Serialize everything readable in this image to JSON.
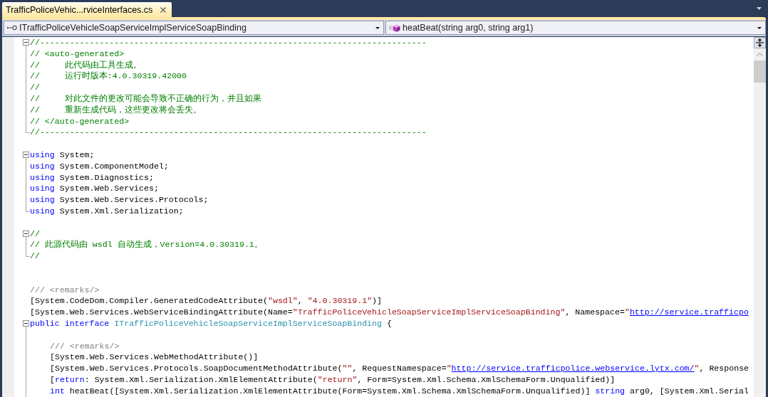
{
  "document_tabs": [
    {
      "label": "TrafficPoliceVehic...rviceInterfaces.cs",
      "selected": true
    }
  ],
  "navigation_bar": {
    "type_selector": {
      "value": "ITrafficPoliceVehicleSoapServiceImplServiceSoapBinding"
    },
    "member_selector": {
      "value": "heatBeat(string arg0, string arg1)"
    }
  },
  "editor": {
    "lines": [
      {
        "kind": "code",
        "outline": {
          "kind": "toggle",
          "expanded": true
        },
        "segments": [
          {
            "kind": "comment",
            "text": "//------------------------------------------------------------------------------"
          }
        ]
      },
      {
        "kind": "code",
        "outline": {
          "kind": "guide"
        },
        "segments": [
          {
            "kind": "comment",
            "text": "// <auto-generated>"
          }
        ]
      },
      {
        "kind": "code",
        "outline": {
          "kind": "guide"
        },
        "segments": [
          {
            "kind": "comment",
            "text": "//     此代码由工具生成。"
          }
        ]
      },
      {
        "kind": "code",
        "outline": {
          "kind": "guide"
        },
        "segments": [
          {
            "kind": "comment",
            "text": "//     运行时版本:4.0.30319.42000"
          }
        ]
      },
      {
        "kind": "code",
        "outline": {
          "kind": "guide"
        },
        "segments": [
          {
            "kind": "comment",
            "text": "//"
          }
        ]
      },
      {
        "kind": "code",
        "outline": {
          "kind": "guide"
        },
        "segments": [
          {
            "kind": "comment",
            "text": "//     对此文件的更改可能会导致不正确的行为，并且如果"
          }
        ]
      },
      {
        "kind": "code",
        "outline": {
          "kind": "guide"
        },
        "segments": [
          {
            "kind": "comment",
            "text": "//     重新生成代码，这些更改将会丢失。"
          }
        ]
      },
      {
        "kind": "code",
        "outline": {
          "kind": "guide"
        },
        "segments": [
          {
            "kind": "comment",
            "text": "// </auto-generated>"
          }
        ]
      },
      {
        "kind": "code",
        "outline": {
          "kind": "end"
        },
        "segments": [
          {
            "kind": "comment",
            "text": "//------------------------------------------------------------------------------"
          }
        ]
      },
      {
        "kind": "blank"
      },
      {
        "kind": "code",
        "outline": {
          "kind": "toggle",
          "expanded": true
        },
        "segments": [
          {
            "kind": "keyword",
            "text": "using"
          },
          {
            "kind": "plain",
            "text": " System;"
          }
        ]
      },
      {
        "kind": "code",
        "outline": {
          "kind": "guide"
        },
        "segments": [
          {
            "kind": "keyword",
            "text": "using"
          },
          {
            "kind": "plain",
            "text": " System.ComponentModel;"
          }
        ]
      },
      {
        "kind": "code",
        "outline": {
          "kind": "guide"
        },
        "segments": [
          {
            "kind": "keyword",
            "text": "using"
          },
          {
            "kind": "plain",
            "text": " System.Diagnostics;"
          }
        ]
      },
      {
        "kind": "code",
        "outline": {
          "kind": "guide"
        },
        "segments": [
          {
            "kind": "keyword",
            "text": "using"
          },
          {
            "kind": "plain",
            "text": " System.Web.Services;"
          }
        ]
      },
      {
        "kind": "code",
        "outline": {
          "kind": "guide"
        },
        "segments": [
          {
            "kind": "keyword",
            "text": "using"
          },
          {
            "kind": "plain",
            "text": " System.Web.Services.Protocols;"
          }
        ]
      },
      {
        "kind": "code",
        "outline": {
          "kind": "end"
        },
        "segments": [
          {
            "kind": "keyword",
            "text": "using"
          },
          {
            "kind": "plain",
            "text": " System.Xml.Serialization;"
          }
        ]
      },
      {
        "kind": "blank"
      },
      {
        "kind": "code",
        "outline": {
          "kind": "toggle",
          "expanded": true
        },
        "segments": [
          {
            "kind": "comment",
            "text": "//"
          }
        ]
      },
      {
        "kind": "code",
        "outline": {
          "kind": "guide"
        },
        "segments": [
          {
            "kind": "comment",
            "text": "// 此源代码由 wsdl 自动生成，Version=4.0.30319.1。"
          }
        ]
      },
      {
        "kind": "code",
        "outline": {
          "kind": "end"
        },
        "segments": [
          {
            "kind": "comment",
            "text": "//"
          }
        ]
      },
      {
        "kind": "blank"
      },
      {
        "kind": "blank"
      },
      {
        "kind": "code",
        "segments": [
          {
            "kind": "doc",
            "text": "/// <remarks/>"
          }
        ]
      },
      {
        "kind": "code",
        "segments": [
          {
            "kind": "plain",
            "text": "[System.CodeDom.Compiler.GeneratedCodeAttribute("
          },
          {
            "kind": "string",
            "text": "\"wsdl\""
          },
          {
            "kind": "plain",
            "text": ", "
          },
          {
            "kind": "string",
            "text": "\"4.0.30319.1\""
          },
          {
            "kind": "plain",
            "text": ")]"
          }
        ]
      },
      {
        "kind": "code",
        "segments": [
          {
            "kind": "plain",
            "text": "[System.Web.Services.WebServiceBindingAttribute(Name="
          },
          {
            "kind": "string",
            "text": "\"TrafficPoliceVehicleSoapServiceImplServiceSoapBinding\""
          },
          {
            "kind": "plain",
            "text": ", Namespace="
          },
          {
            "kind": "string",
            "text": "\""
          },
          {
            "kind": "link",
            "text": "http://service.trafficpo"
          }
        ]
      },
      {
        "kind": "code",
        "outline": {
          "kind": "toggle",
          "expanded": true
        },
        "segments": [
          {
            "kind": "keyword",
            "text": "public"
          },
          {
            "kind": "keyword",
            "text": " interface"
          },
          {
            "kind": "type",
            "text": " ITrafficPoliceVehicleSoapServiceImplServiceSoapBinding"
          },
          {
            "kind": "plain",
            "text": " {"
          }
        ],
        "children": [
          {
            "kind": "blank",
            "outline": {
              "kind": "guide"
            }
          },
          {
            "kind": "code",
            "outline": {
              "kind": "guide"
            },
            "segments": [
              {
                "kind": "doc",
                "text": "/// <remarks/>"
              }
            ]
          },
          {
            "kind": "code",
            "outline": {
              "kind": "guide"
            },
            "segments": [
              {
                "kind": "plain",
                "text": "[System.Web.Services.WebMethodAttribute()]"
              }
            ]
          },
          {
            "kind": "code",
            "outline": {
              "kind": "guide"
            },
            "segments": [
              {
                "kind": "plain",
                "text": "[System.Web.Services.Protocols.SoapDocumentMethodAttribute("
              },
              {
                "kind": "string",
                "text": "\"\""
              },
              {
                "kind": "plain",
                "text": ", RequestNamespace="
              },
              {
                "kind": "string",
                "text": "\""
              },
              {
                "kind": "link",
                "text": "http://service.trafficpolice.webservice.lytx.com/"
              },
              {
                "kind": "string",
                "text": "\""
              },
              {
                "kind": "plain",
                "text": ", Response"
              }
            ]
          },
          {
            "kind": "code",
            "outline": {
              "kind": "guide"
            },
            "segments": [
              {
                "kind": "plain",
                "text": "["
              },
              {
                "kind": "keyword",
                "text": "return"
              },
              {
                "kind": "plain",
                "text": ": System.Xml.Serialization.XmlElementAttribute("
              },
              {
                "kind": "string",
                "text": "\"return\""
              },
              {
                "kind": "plain",
                "text": ", Form=System.Xml.Schema.XmlSchemaForm.Unqualified)]"
              }
            ]
          },
          {
            "kind": "code",
            "outline": {
              "kind": "guide"
            },
            "segments": [
              {
                "kind": "keyword",
                "text": "int"
              },
              {
                "kind": "plain",
                "text": " heatBeat([System.Xml.Serialization.XmlElementAttribute(Form=System.Xml.Schema.XmlSchemaForm.Unqualified)] "
              },
              {
                "kind": "keyword",
                "text": "string"
              },
              {
                "kind": "plain",
                "text": " arg0, [System.Xml.Serial"
              }
            ]
          }
        ]
      }
    ]
  }
}
